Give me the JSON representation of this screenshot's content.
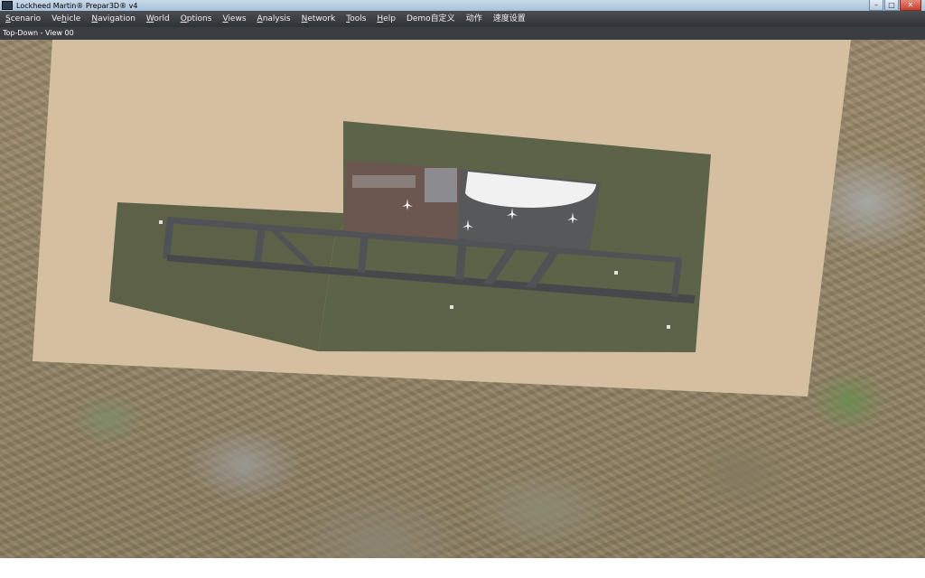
{
  "window": {
    "title": "Lockheed Martin® Prepar3D® v4",
    "controls": {
      "minimize": "–",
      "maximize": "□",
      "close": "✕"
    }
  },
  "menu": [
    {
      "label_underlined": "S",
      "label_rest": "cenario"
    },
    {
      "label_pre": "Ve",
      "label_underlined": "h",
      "label_rest": "icle"
    },
    {
      "label_underlined": "N",
      "label_rest": "avigation"
    },
    {
      "label_underlined": "W",
      "label_rest": "orld"
    },
    {
      "label_underlined": "O",
      "label_rest": "ptions"
    },
    {
      "label_underlined": "V",
      "label_rest": "iews"
    },
    {
      "label_underlined": "A",
      "label_rest": "nalysis"
    },
    {
      "label_underlined": "N",
      "label_rest": "etwork"
    },
    {
      "label_underlined": "T",
      "label_rest": "ools"
    },
    {
      "label_underlined": "H",
      "label_rest": "elp"
    },
    {
      "label_rest": "Demo自定义"
    },
    {
      "label_rest": "动作"
    },
    {
      "label_rest": "速度设置"
    }
  ],
  "view": {
    "title": "Top-Down - View 00"
  },
  "hud_text": [],
  "colors": {
    "menubar": "#3a3d42",
    "hud_text": "#ff2a2a",
    "ground_tan": "#d4c0a0",
    "airfield_grass": "#5c6148",
    "runway": "#505256"
  },
  "icons": {
    "app": "prepar3d-app-icon",
    "aircraft": "airliner-icon"
  }
}
